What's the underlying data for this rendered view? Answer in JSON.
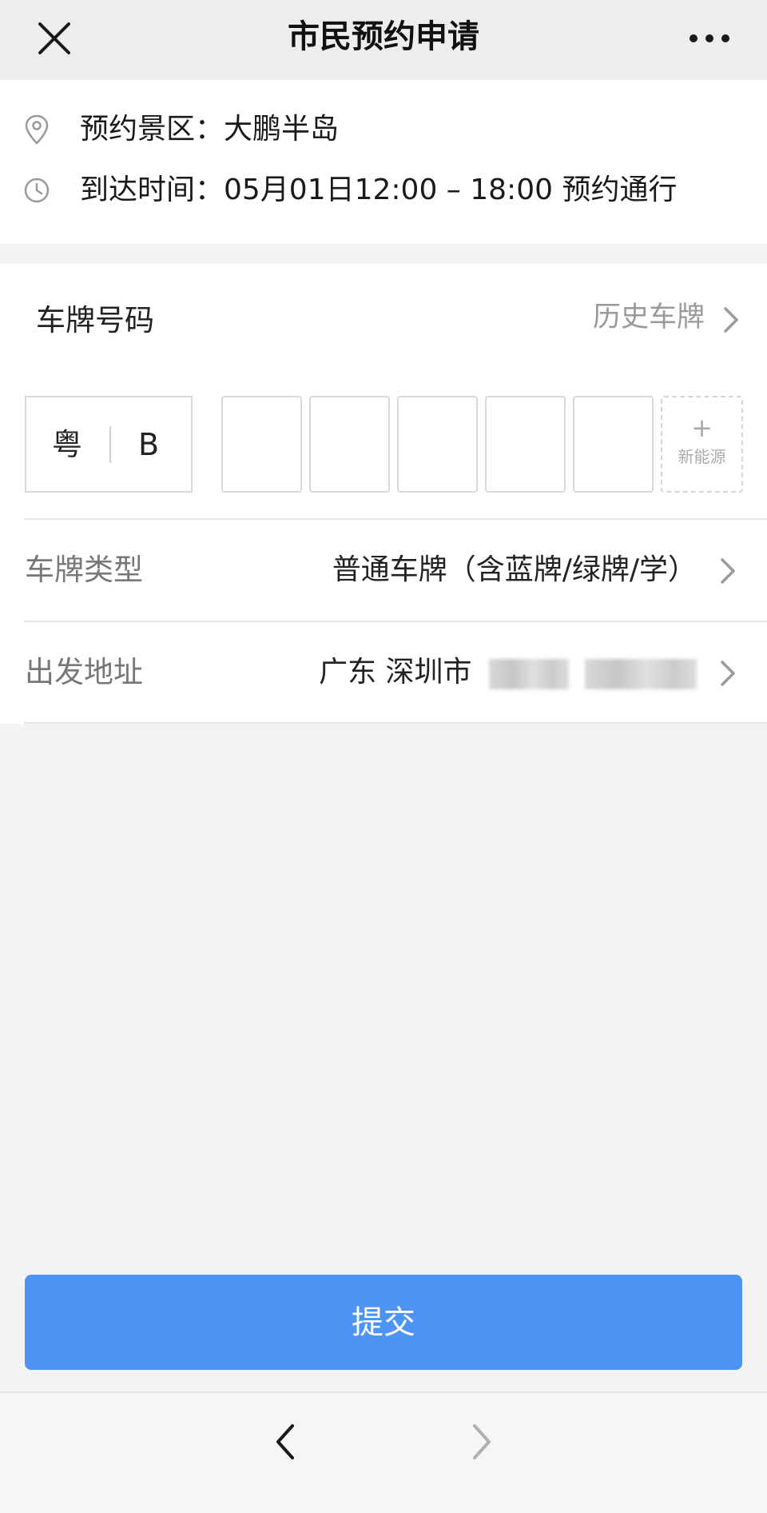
{
  "header": {
    "title": "市民预约申请",
    "close_icon": "close-icon",
    "more_icon": "more-icon"
  },
  "info": {
    "scenic": "预约景区：大鹏半岛",
    "arrival": "到达时间：05月01日12:00 – 18:00 预约通行",
    "scenic_icon": "location-pin-icon",
    "arrival_icon": "clock-icon"
  },
  "plate": {
    "label": "车牌号码",
    "history": "历史车牌",
    "province": "粤",
    "letter": "B",
    "new_energy": "新能源",
    "new_energy_plus": "+"
  },
  "plate_type": {
    "label": "车牌类型",
    "value": "普通车牌（含蓝牌/绿牌/学）"
  },
  "departure": {
    "label": "出发地址",
    "value": "广东 深圳市"
  },
  "submit": {
    "label": "提交"
  },
  "colors": {
    "accent": "#4e94f5",
    "header_bg": "#ededed",
    "page_bg": "#f3f3f3"
  }
}
